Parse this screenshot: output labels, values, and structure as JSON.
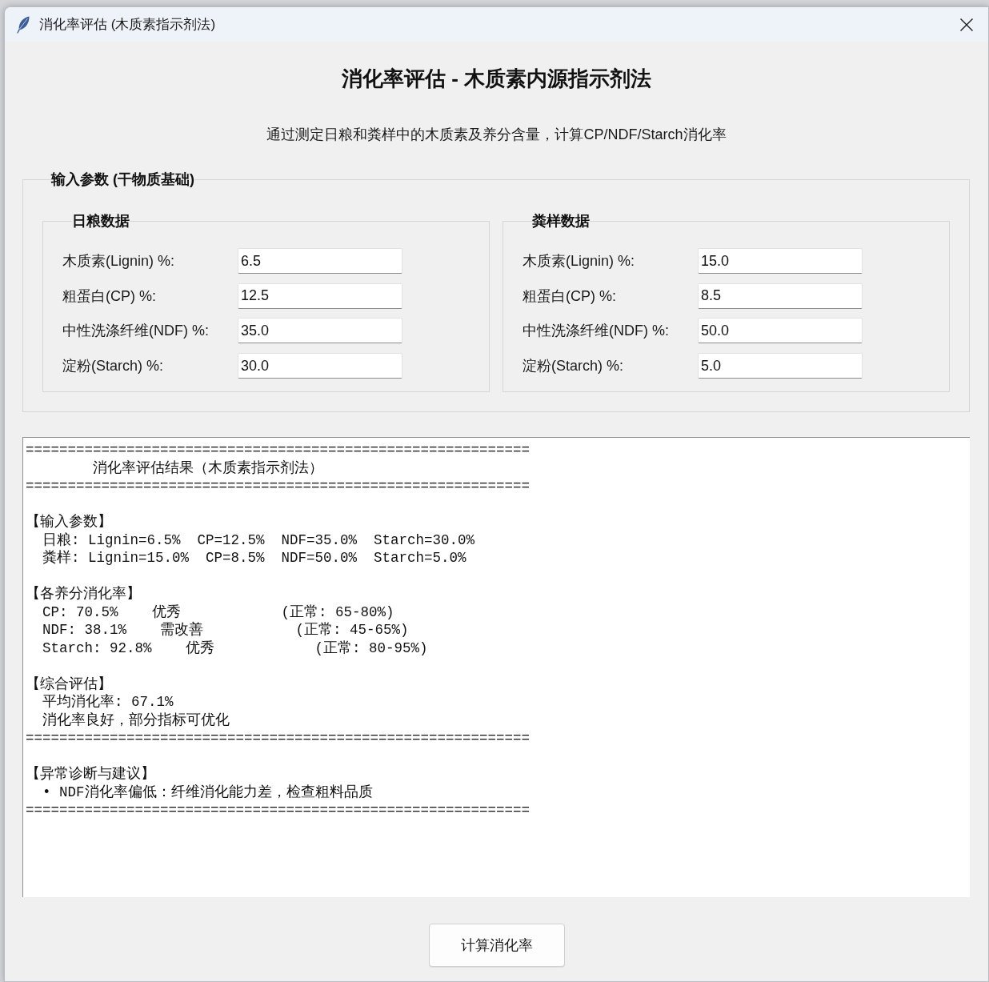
{
  "window": {
    "title": "消化率评估 (木质素指示剂法)"
  },
  "header": {
    "title": "消化率评估 - 木质素内源指示剂法",
    "subtitle": "通过测定日粮和粪样中的木质素及养分含量，计算CP/NDF/Starch消化率"
  },
  "input_group": {
    "title": "输入参数 (干物质基础)",
    "panels": [
      {
        "title": "日粮数据",
        "fields": [
          {
            "label": "木质素(Lignin) %:",
            "value": "6.5"
          },
          {
            "label": "粗蛋白(CP) %:",
            "value": "12.5"
          },
          {
            "label": "中性洗涤纤维(NDF) %:",
            "value": "35.0"
          },
          {
            "label": "淀粉(Starch) %:",
            "value": "30.0"
          }
        ]
      },
      {
        "title": "粪样数据",
        "fields": [
          {
            "label": "木质素(Lignin) %:",
            "value": "15.0"
          },
          {
            "label": "粗蛋白(CP) %:",
            "value": "8.5"
          },
          {
            "label": "中性洗涤纤维(NDF) %:",
            "value": "50.0"
          },
          {
            "label": "淀粉(Starch) %:",
            "value": "5.0"
          }
        ]
      }
    ]
  },
  "results": {
    "blocks": [
      {
        "lines": [
          {
            "kind": "rule",
            "text": "============================================================"
          },
          {
            "kind": "title",
            "text": "消化率评估结果（木质素指示剂法）"
          },
          {
            "kind": "rule",
            "text": "============================================================"
          }
        ]
      },
      {
        "lines": [
          {
            "kind": "section",
            "text": "【输入参数】"
          },
          {
            "kind": "item",
            "text": "日粮: Lignin=6.5%  CP=12.5%  NDF=35.0%  Starch=30.0%"
          },
          {
            "kind": "item",
            "text": "粪样: Lignin=15.0%  CP=8.5%  NDF=50.0%  Starch=5.0%"
          }
        ]
      },
      {
        "lines": [
          {
            "kind": "section",
            "text": "【各养分消化率】"
          },
          {
            "kind": "item",
            "text": "CP: 70.5%    优秀            (正常: 65-80%)"
          },
          {
            "kind": "item",
            "text": "NDF: 38.1%    需改善           (正常: 45-65%)"
          },
          {
            "kind": "item",
            "text": "Starch: 92.8%    优秀            (正常: 80-95%)"
          }
        ]
      },
      {
        "lines": [
          {
            "kind": "section",
            "text": "【综合评估】"
          },
          {
            "kind": "item",
            "text": "平均消化率: 67.1%"
          },
          {
            "kind": "item",
            "text": "消化率良好，部分指标可优化"
          },
          {
            "kind": "rule",
            "text": "============================================================"
          }
        ]
      },
      {
        "lines": [
          {
            "kind": "section",
            "text": "【异常诊断与建议】"
          },
          {
            "kind": "item",
            "text": "• NDF消化率偏低：纤维消化能力差，检查粗料品质"
          },
          {
            "kind": "rule",
            "text": "============================================================"
          }
        ]
      }
    ]
  },
  "buttons": [
    {
      "label": "计算消化率"
    }
  ]
}
